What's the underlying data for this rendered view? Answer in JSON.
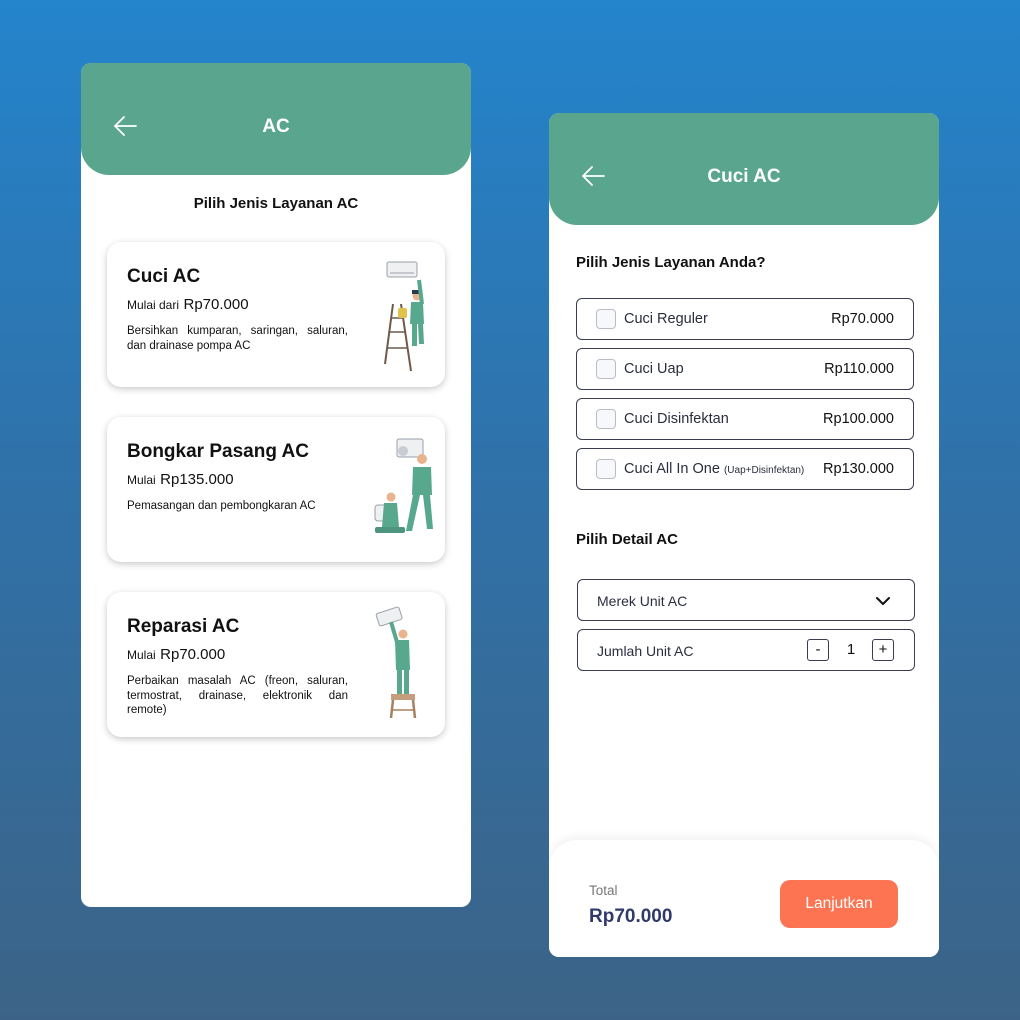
{
  "colors": {
    "header": "#59a58e",
    "accent_button": "#fd7453",
    "total_value": "#2f3a6a"
  },
  "screen1": {
    "title": "AC",
    "subtitle": "Pilih Jenis Layanan AC",
    "cards": [
      {
        "title": "Cuci AC",
        "price_prefix": "Mulai dari",
        "price": "Rp70.000",
        "description": "Bersihkan kumparan, saringan, saluran, dan drainase pompa AC"
      },
      {
        "title": "Bongkar Pasang AC",
        "price_prefix": "Mulai",
        "price": "Rp135.000",
        "description": "Pemasangan dan pembongkaran AC"
      },
      {
        "title": "Reparasi AC",
        "price_prefix": "Mulai",
        "price": "Rp70.000",
        "description": "Perbaikan masalah AC (freon, saluran, termostrat, drainase, elektronik dan remote)"
      }
    ]
  },
  "screen2": {
    "title": "Cuci AC",
    "service_heading": "Pilih Jenis Layanan Anda?",
    "options": [
      {
        "label": "Cuci Reguler",
        "note": "",
        "price": "Rp70.000"
      },
      {
        "label": "Cuci Uap",
        "note": "",
        "price": "Rp110.000"
      },
      {
        "label": "Cuci Disinfektan",
        "note": "",
        "price": "Rp100.000"
      },
      {
        "label": "Cuci All In One",
        "note": "(Uap+Disinfektan)",
        "price": "Rp130.000"
      }
    ],
    "detail_heading": "Pilih Detail AC",
    "brand_select_label": "Merek Unit AC",
    "quantity_label": "Jumlah Unit AC",
    "quantity_minus": "-",
    "quantity_value": "1",
    "quantity_plus": "+",
    "total_label": "Total",
    "total_value": "Rp70.000",
    "next_button": "Lanjutkan"
  }
}
